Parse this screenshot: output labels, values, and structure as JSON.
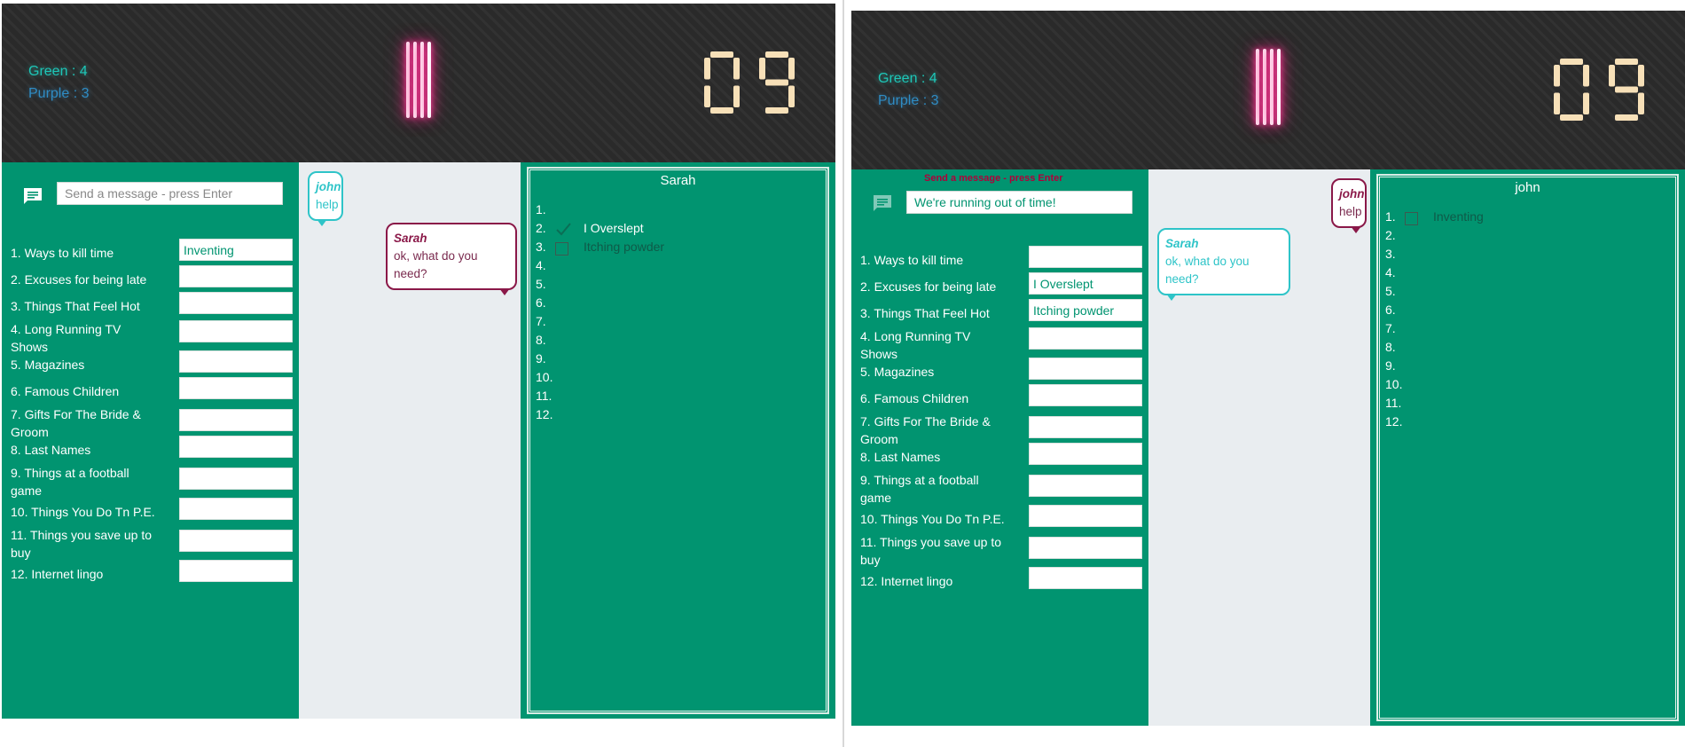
{
  "colors": {
    "header_bg": "#2a2a2a",
    "green_panel": "#019470",
    "chat_bg": "#e9edf0",
    "green_score": "#1ec7b8",
    "purple_score": "#2f8cc4",
    "tally_glow": "#ff2f8e",
    "timer_digits": "#f7e0b8",
    "bubble_teal": "#2ec4c8",
    "bubble_plum": "#8a1848"
  },
  "screens": [
    {
      "scores": {
        "green": "Green : 4",
        "purple": "Purple : 3"
      },
      "tally": 4,
      "timer": "09",
      "message_input": {
        "placeholder": "Send a message - press Enter",
        "value": "",
        "label": ""
      },
      "categories": [
        {
          "label": "1. Ways to kill time",
          "answer": "Inventing"
        },
        {
          "label": "2. Excuses for being late",
          "answer": ""
        },
        {
          "label": "3. Things That Feel Hot",
          "answer": ""
        },
        {
          "label": "4. Long Running TV Shows",
          "answer": ""
        },
        {
          "label": "5. Magazines",
          "answer": ""
        },
        {
          "label": "6. Famous Children",
          "answer": ""
        },
        {
          "label": "7. Gifts For The Bride & Groom",
          "answer": ""
        },
        {
          "label": "8. Last Names",
          "answer": ""
        },
        {
          "label": "9. Things at a football game",
          "answer": ""
        },
        {
          "label": "10. Things You Do Tn P.E.",
          "answer": ""
        },
        {
          "label": "11. Things you save up to buy",
          "answer": ""
        },
        {
          "label": "12. Internet lingo",
          "answer": ""
        }
      ],
      "chat": [
        {
          "name": "john",
          "text": "help",
          "style": "teal"
        },
        {
          "name": "Sarah",
          "text": "ok, what do you need?",
          "style": "plum"
        }
      ],
      "opponent": {
        "name": "Sarah",
        "rows": [
          {
            "num": "1.",
            "mark": "none",
            "value": ""
          },
          {
            "num": "2.",
            "mark": "check",
            "value": "I Overslept"
          },
          {
            "num": "3.",
            "mark": "box",
            "value": "Itching powder"
          },
          {
            "num": "4.",
            "mark": "none",
            "value": ""
          },
          {
            "num": "5.",
            "mark": "none",
            "value": ""
          },
          {
            "num": "6.",
            "mark": "none",
            "value": ""
          },
          {
            "num": "7.",
            "mark": "none",
            "value": ""
          },
          {
            "num": "8.",
            "mark": "none",
            "value": ""
          },
          {
            "num": "9.",
            "mark": "none",
            "value": ""
          },
          {
            "num": "10.",
            "mark": "none",
            "value": ""
          },
          {
            "num": "11.",
            "mark": "none",
            "value": ""
          },
          {
            "num": "12.",
            "mark": "none",
            "value": ""
          }
        ]
      }
    },
    {
      "scores": {
        "green": "Green : 4",
        "purple": "Purple : 3"
      },
      "tally": 4,
      "timer": "09",
      "message_input": {
        "placeholder": "Send a message - press Enter",
        "value": "We're running out of time!",
        "label": "Send a message - press Enter"
      },
      "categories": [
        {
          "label": "1. Ways to kill time",
          "answer": ""
        },
        {
          "label": "2. Excuses for being late",
          "answer": "I Overslept"
        },
        {
          "label": "3. Things That Feel Hot",
          "answer": "Itching powder"
        },
        {
          "label": "4. Long Running TV Shows",
          "answer": ""
        },
        {
          "label": "5. Magazines",
          "answer": ""
        },
        {
          "label": "6. Famous Children",
          "answer": ""
        },
        {
          "label": "7. Gifts For The Bride & Groom",
          "answer": ""
        },
        {
          "label": "8. Last Names",
          "answer": ""
        },
        {
          "label": "9. Things at a football game",
          "answer": ""
        },
        {
          "label": "10. Things You Do Tn P.E.",
          "answer": ""
        },
        {
          "label": "11. Things you save up to buy",
          "answer": ""
        },
        {
          "label": "12. Internet lingo",
          "answer": ""
        }
      ],
      "chat": [
        {
          "name": "john",
          "text": "help",
          "style": "plum"
        },
        {
          "name": "Sarah",
          "text": "ok, what do you need?",
          "style": "teal"
        }
      ],
      "opponent": {
        "name": "john",
        "rows": [
          {
            "num": "1.",
            "mark": "box",
            "value": "Inventing"
          },
          {
            "num": "2.",
            "mark": "none",
            "value": ""
          },
          {
            "num": "3.",
            "mark": "none",
            "value": ""
          },
          {
            "num": "4.",
            "mark": "none",
            "value": ""
          },
          {
            "num": "5.",
            "mark": "none",
            "value": ""
          },
          {
            "num": "6.",
            "mark": "none",
            "value": ""
          },
          {
            "num": "7.",
            "mark": "none",
            "value": ""
          },
          {
            "num": "8.",
            "mark": "none",
            "value": ""
          },
          {
            "num": "9.",
            "mark": "none",
            "value": ""
          },
          {
            "num": "10.",
            "mark": "none",
            "value": ""
          },
          {
            "num": "11.",
            "mark": "none",
            "value": ""
          },
          {
            "num": "12.",
            "mark": "none",
            "value": ""
          }
        ]
      }
    }
  ]
}
